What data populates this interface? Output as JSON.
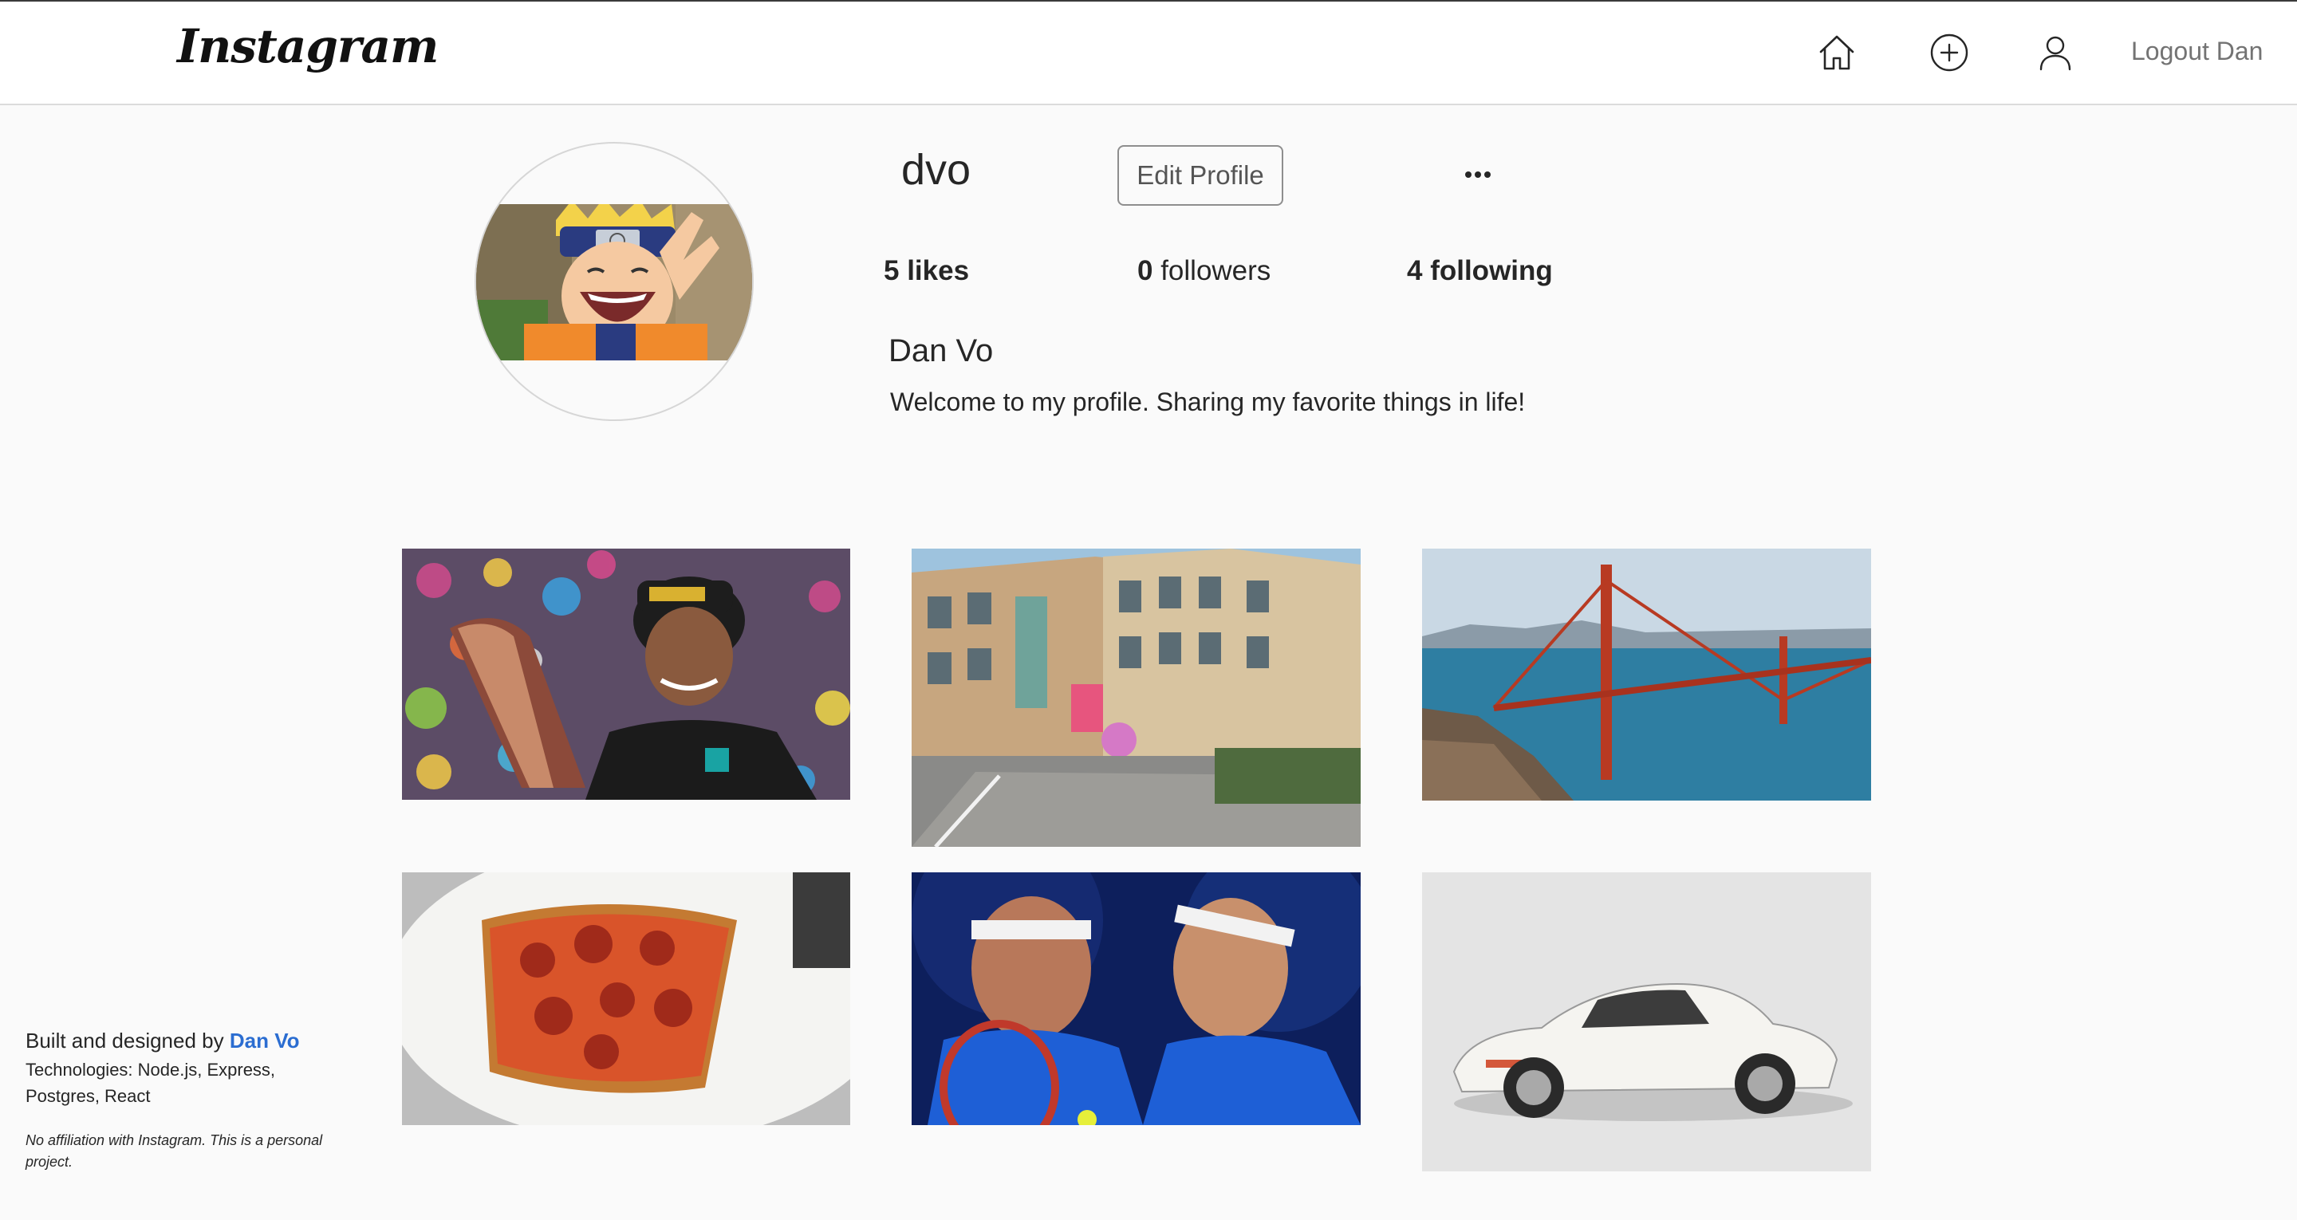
{
  "header": {
    "logo": "Instagram",
    "icons": [
      "home-icon",
      "add-post-icon",
      "profile-icon"
    ],
    "logout_label": "Logout Dan"
  },
  "profile": {
    "username": "dvo",
    "edit_label": "Edit Profile",
    "more_label": "•••",
    "likes_count": "5",
    "likes_label": "likes",
    "followers_count": "0",
    "followers_label": "followers",
    "following_count": "4",
    "following_label": "following",
    "full_name": "Dan Vo",
    "bio": "Welcome to my profile. Sharing my favorite things in life!"
  },
  "posts": [
    {
      "subject": "racing driver with trophy"
    },
    {
      "subject": "city street"
    },
    {
      "subject": "golden gate bridge"
    },
    {
      "subject": "pepperoni pizza"
    },
    {
      "subject": "tennis players"
    },
    {
      "subject": "white sports car"
    }
  ],
  "footer": {
    "built_prefix": "Built and designed by",
    "author": "Dan Vo",
    "technologies": "Technologies: Node.js, Express, Postgres, React",
    "note": "No affiliation with Instagram. This is a personal project."
  },
  "colors": {
    "link": "#2b6dd1",
    "background": "#fafafa"
  }
}
